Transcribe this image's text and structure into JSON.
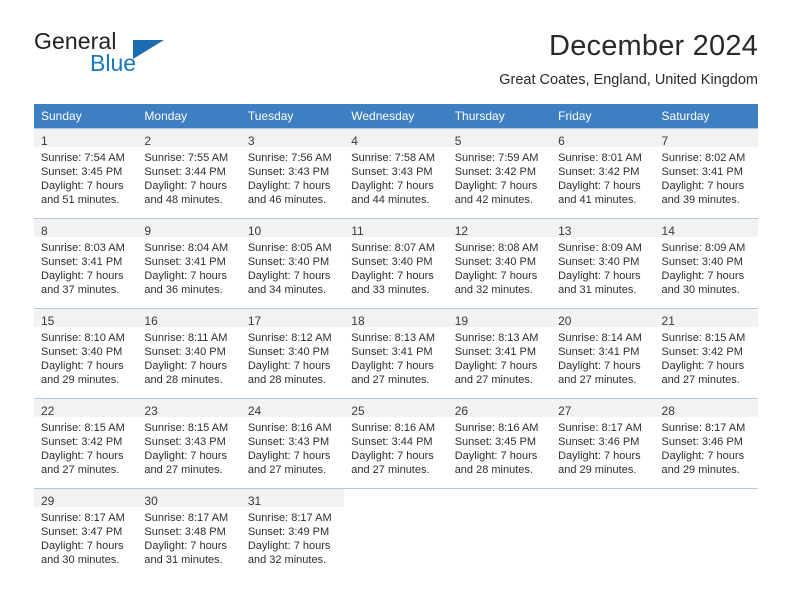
{
  "brand": {
    "name_part1": "General",
    "name_part2": "Blue",
    "logo_icon": "triangle-logo-icon",
    "accent_color": "#1878be"
  },
  "header": {
    "title": "December 2024",
    "location": "Great Coates, England, United Kingdom"
  },
  "calendar": {
    "header_background": "#3d7fc1",
    "daynum_background": "#f2f2f2",
    "grid_line_color": "#b7c9dc",
    "weekday_headers": [
      "Sunday",
      "Monday",
      "Tuesday",
      "Wednesday",
      "Thursday",
      "Friday",
      "Saturday"
    ],
    "weeks": [
      [
        {
          "day": "1",
          "sunrise": "Sunrise: 7:54 AM",
          "sunset": "Sunset: 3:45 PM",
          "daylight1": "Daylight: 7 hours",
          "daylight2": "and 51 minutes."
        },
        {
          "day": "2",
          "sunrise": "Sunrise: 7:55 AM",
          "sunset": "Sunset: 3:44 PM",
          "daylight1": "Daylight: 7 hours",
          "daylight2": "and 48 minutes."
        },
        {
          "day": "3",
          "sunrise": "Sunrise: 7:56 AM",
          "sunset": "Sunset: 3:43 PM",
          "daylight1": "Daylight: 7 hours",
          "daylight2": "and 46 minutes."
        },
        {
          "day": "4",
          "sunrise": "Sunrise: 7:58 AM",
          "sunset": "Sunset: 3:43 PM",
          "daylight1": "Daylight: 7 hours",
          "daylight2": "and 44 minutes."
        },
        {
          "day": "5",
          "sunrise": "Sunrise: 7:59 AM",
          "sunset": "Sunset: 3:42 PM",
          "daylight1": "Daylight: 7 hours",
          "daylight2": "and 42 minutes."
        },
        {
          "day": "6",
          "sunrise": "Sunrise: 8:01 AM",
          "sunset": "Sunset: 3:42 PM",
          "daylight1": "Daylight: 7 hours",
          "daylight2": "and 41 minutes."
        },
        {
          "day": "7",
          "sunrise": "Sunrise: 8:02 AM",
          "sunset": "Sunset: 3:41 PM",
          "daylight1": "Daylight: 7 hours",
          "daylight2": "and 39 minutes."
        }
      ],
      [
        {
          "day": "8",
          "sunrise": "Sunrise: 8:03 AM",
          "sunset": "Sunset: 3:41 PM",
          "daylight1": "Daylight: 7 hours",
          "daylight2": "and 37 minutes."
        },
        {
          "day": "9",
          "sunrise": "Sunrise: 8:04 AM",
          "sunset": "Sunset: 3:41 PM",
          "daylight1": "Daylight: 7 hours",
          "daylight2": "and 36 minutes."
        },
        {
          "day": "10",
          "sunrise": "Sunrise: 8:05 AM",
          "sunset": "Sunset: 3:40 PM",
          "daylight1": "Daylight: 7 hours",
          "daylight2": "and 34 minutes."
        },
        {
          "day": "11",
          "sunrise": "Sunrise: 8:07 AM",
          "sunset": "Sunset: 3:40 PM",
          "daylight1": "Daylight: 7 hours",
          "daylight2": "and 33 minutes."
        },
        {
          "day": "12",
          "sunrise": "Sunrise: 8:08 AM",
          "sunset": "Sunset: 3:40 PM",
          "daylight1": "Daylight: 7 hours",
          "daylight2": "and 32 minutes."
        },
        {
          "day": "13",
          "sunrise": "Sunrise: 8:09 AM",
          "sunset": "Sunset: 3:40 PM",
          "daylight1": "Daylight: 7 hours",
          "daylight2": "and 31 minutes."
        },
        {
          "day": "14",
          "sunrise": "Sunrise: 8:09 AM",
          "sunset": "Sunset: 3:40 PM",
          "daylight1": "Daylight: 7 hours",
          "daylight2": "and 30 minutes."
        }
      ],
      [
        {
          "day": "15",
          "sunrise": "Sunrise: 8:10 AM",
          "sunset": "Sunset: 3:40 PM",
          "daylight1": "Daylight: 7 hours",
          "daylight2": "and 29 minutes."
        },
        {
          "day": "16",
          "sunrise": "Sunrise: 8:11 AM",
          "sunset": "Sunset: 3:40 PM",
          "daylight1": "Daylight: 7 hours",
          "daylight2": "and 28 minutes."
        },
        {
          "day": "17",
          "sunrise": "Sunrise: 8:12 AM",
          "sunset": "Sunset: 3:40 PM",
          "daylight1": "Daylight: 7 hours",
          "daylight2": "and 28 minutes."
        },
        {
          "day": "18",
          "sunrise": "Sunrise: 8:13 AM",
          "sunset": "Sunset: 3:41 PM",
          "daylight1": "Daylight: 7 hours",
          "daylight2": "and 27 minutes."
        },
        {
          "day": "19",
          "sunrise": "Sunrise: 8:13 AM",
          "sunset": "Sunset: 3:41 PM",
          "daylight1": "Daylight: 7 hours",
          "daylight2": "and 27 minutes."
        },
        {
          "day": "20",
          "sunrise": "Sunrise: 8:14 AM",
          "sunset": "Sunset: 3:41 PM",
          "daylight1": "Daylight: 7 hours",
          "daylight2": "and 27 minutes."
        },
        {
          "day": "21",
          "sunrise": "Sunrise: 8:15 AM",
          "sunset": "Sunset: 3:42 PM",
          "daylight1": "Daylight: 7 hours",
          "daylight2": "and 27 minutes."
        }
      ],
      [
        {
          "day": "22",
          "sunrise": "Sunrise: 8:15 AM",
          "sunset": "Sunset: 3:42 PM",
          "daylight1": "Daylight: 7 hours",
          "daylight2": "and 27 minutes."
        },
        {
          "day": "23",
          "sunrise": "Sunrise: 8:15 AM",
          "sunset": "Sunset: 3:43 PM",
          "daylight1": "Daylight: 7 hours",
          "daylight2": "and 27 minutes."
        },
        {
          "day": "24",
          "sunrise": "Sunrise: 8:16 AM",
          "sunset": "Sunset: 3:43 PM",
          "daylight1": "Daylight: 7 hours",
          "daylight2": "and 27 minutes."
        },
        {
          "day": "25",
          "sunrise": "Sunrise: 8:16 AM",
          "sunset": "Sunset: 3:44 PM",
          "daylight1": "Daylight: 7 hours",
          "daylight2": "and 27 minutes."
        },
        {
          "day": "26",
          "sunrise": "Sunrise: 8:16 AM",
          "sunset": "Sunset: 3:45 PM",
          "daylight1": "Daylight: 7 hours",
          "daylight2": "and 28 minutes."
        },
        {
          "day": "27",
          "sunrise": "Sunrise: 8:17 AM",
          "sunset": "Sunset: 3:46 PM",
          "daylight1": "Daylight: 7 hours",
          "daylight2": "and 29 minutes."
        },
        {
          "day": "28",
          "sunrise": "Sunrise: 8:17 AM",
          "sunset": "Sunset: 3:46 PM",
          "daylight1": "Daylight: 7 hours",
          "daylight2": "and 29 minutes."
        }
      ],
      [
        {
          "day": "29",
          "sunrise": "Sunrise: 8:17 AM",
          "sunset": "Sunset: 3:47 PM",
          "daylight1": "Daylight: 7 hours",
          "daylight2": "and 30 minutes."
        },
        {
          "day": "30",
          "sunrise": "Sunrise: 8:17 AM",
          "sunset": "Sunset: 3:48 PM",
          "daylight1": "Daylight: 7 hours",
          "daylight2": "and 31 minutes."
        },
        {
          "day": "31",
          "sunrise": "Sunrise: 8:17 AM",
          "sunset": "Sunset: 3:49 PM",
          "daylight1": "Daylight: 7 hours",
          "daylight2": "and 32 minutes."
        },
        {
          "day": "",
          "sunrise": "",
          "sunset": "",
          "daylight1": "",
          "daylight2": ""
        },
        {
          "day": "",
          "sunrise": "",
          "sunset": "",
          "daylight1": "",
          "daylight2": ""
        },
        {
          "day": "",
          "sunrise": "",
          "sunset": "",
          "daylight1": "",
          "daylight2": ""
        },
        {
          "day": "",
          "sunrise": "",
          "sunset": "",
          "daylight1": "",
          "daylight2": ""
        }
      ]
    ]
  }
}
